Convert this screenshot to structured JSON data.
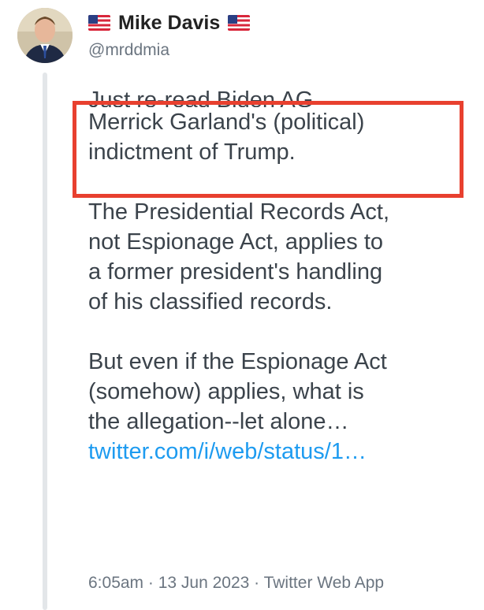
{
  "author": {
    "name": "Mike Davis",
    "handle": "@mrddmia",
    "flag_left": "us-flag-icon",
    "flag_right": "us-flag-icon"
  },
  "tweet": {
    "line_clipped": "Just re-read Biden AG",
    "line_1": "Merrick Garland's (political)",
    "line_2": "indictment of Trump.",
    "para2_line_1": "The Presidential Records Act,",
    "para2_line_2": "not Espionage Act, applies to",
    "para2_line_3": "a former president's handling",
    "para2_line_4": "of his classified records.",
    "para3_line_1": "But even if the Espionage Act",
    "para3_line_2": "(somehow) applies, what is",
    "para3_line_3": "the allegation--let alone…",
    "link": "twitter.com/i/web/status/1…"
  },
  "meta": {
    "text": "6:05am · 13 Jun 2023 · Twitter Web App"
  },
  "colors": {
    "highlight": "#e8402f",
    "link": "#1d9bf0",
    "text": "#3b434b",
    "muted": "#6b7580"
  }
}
